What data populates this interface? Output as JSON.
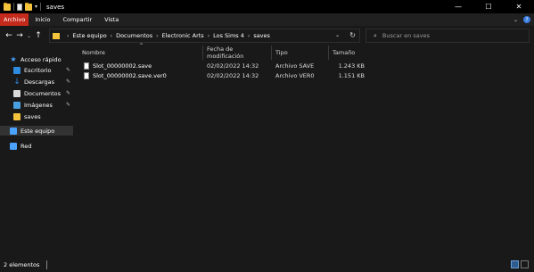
{
  "window": {
    "title": "saves",
    "controls": [
      "—",
      "☐",
      "✕"
    ]
  },
  "ribbon": {
    "tabs": [
      "Archivo",
      "Inicio",
      "Compartir",
      "Vista"
    ],
    "right": {
      "expand": "⌄",
      "help": "?"
    }
  },
  "nav": {
    "back": "←",
    "forward": "→",
    "recent": "⌄",
    "up": "↑"
  },
  "address": {
    "crumbs": [
      "Este equipo",
      "Documentos",
      "Electronic Arts",
      "Los Sims 4",
      "saves"
    ]
  },
  "search": {
    "placeholder": "Buscar en saves"
  },
  "sidebar": {
    "items": [
      {
        "label": "Acceso rápido"
      },
      {
        "label": "Escritorio"
      },
      {
        "label": "Descargas"
      },
      {
        "label": "Documentos"
      },
      {
        "label": "Imágenes"
      },
      {
        "label": "saves"
      },
      {
        "label": "Este equipo"
      },
      {
        "label": "Red"
      }
    ]
  },
  "columns": [
    "Nombre",
    "Fecha de modificación",
    "Tipo",
    "Tamaño"
  ],
  "files": [
    {
      "name": "Slot_00000002.save",
      "date": "02/02/2022 14:32",
      "type": "Archivo SAVE",
      "size": "1.243 KB"
    },
    {
      "name": "Slot_00000002.save.ver0",
      "date": "02/02/2022 14:32",
      "type": "Archivo VER0",
      "size": "1.151 KB"
    }
  ],
  "status": {
    "count": "2 elementos"
  },
  "colors": {
    "accent": "#c42b1c",
    "background": "#191919",
    "folder": "#f4c43c"
  }
}
